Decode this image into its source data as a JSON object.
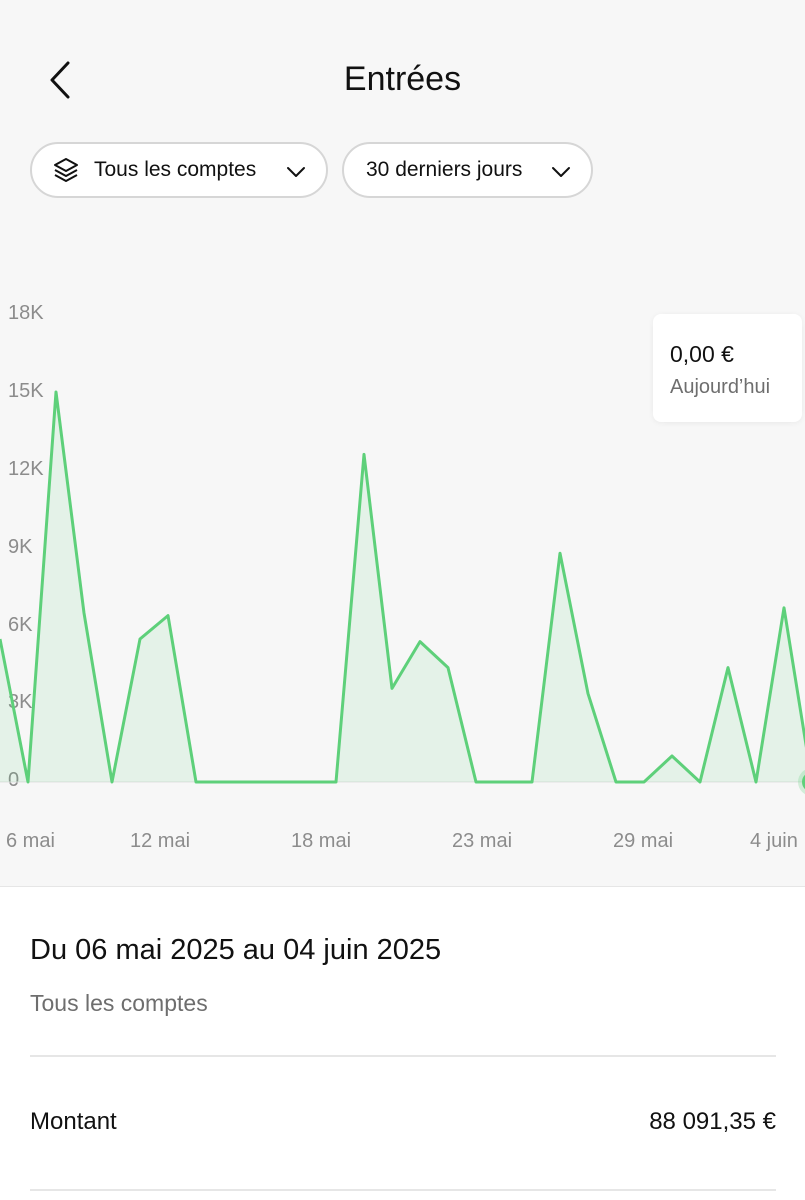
{
  "header": {
    "title": "Entrées",
    "back_icon": "chevron-left-icon"
  },
  "filters": {
    "accounts": {
      "label": "Tous les comptes",
      "icon": "layers-icon"
    },
    "period": {
      "label": "30 derniers jours"
    }
  },
  "tooltip": {
    "amount": "0,00 €",
    "when": "Aujourd’hui"
  },
  "chart_data": {
    "type": "area",
    "title": "",
    "xlabel": "",
    "ylabel": "",
    "y_ticks": [
      "18K",
      "15K",
      "12K",
      "9K",
      "6K",
      "3K",
      "0"
    ],
    "x_ticks": [
      "6 mai",
      "12 mai",
      "18 mai",
      "23 mai",
      "29 mai",
      "4 juin"
    ],
    "ylim": [
      0,
      18000
    ],
    "grid": false,
    "color": "#5ed07a",
    "x": [
      "6 mai",
      "7 mai",
      "8 mai",
      "9 mai",
      "10 mai",
      "11 mai",
      "12 mai",
      "13 mai",
      "14 mai",
      "15 mai",
      "16 mai",
      "17 mai",
      "18 mai",
      "19 mai",
      "20 mai",
      "21 mai",
      "22 mai",
      "23 mai",
      "24 mai",
      "25 mai",
      "26 mai",
      "27 mai",
      "28 mai",
      "29 mai",
      "30 mai",
      "31 mai",
      "1 juin",
      "2 juin",
      "3 juin",
      "4 juin"
    ],
    "values": [
      5500,
      0,
      15000,
      6500,
      0,
      5500,
      6400,
      0,
      0,
      0,
      0,
      0,
      0,
      12600,
      3600,
      5400,
      4400,
      0,
      0,
      0,
      8800,
      3400,
      0,
      0,
      1000,
      0,
      4400,
      0,
      6700,
      0
    ]
  },
  "summary": {
    "range_title": "Du 06 mai 2025 au 04 juin 2025",
    "accounts": "Tous les comptes",
    "amount_label": "Montant",
    "amount_value": "88 091,35 €"
  }
}
